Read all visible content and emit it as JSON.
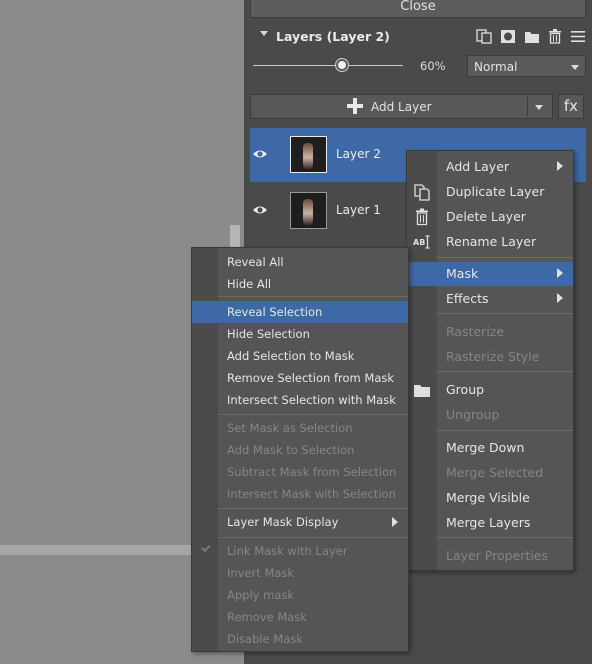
{
  "panel": {
    "close_label": "Close",
    "layers_title": "Layers (Layer 2)",
    "opacity": "60%",
    "opacity_fraction": 0.6,
    "blend_mode": "Normal",
    "add_layer_label": "Add Layer",
    "fx_label": "fx"
  },
  "layers": [
    {
      "name": "Layer 2",
      "selected": true,
      "visible": true
    },
    {
      "name": "Layer 1",
      "selected": false,
      "visible": true
    }
  ],
  "layer_menu": {
    "items": [
      {
        "label": "Add Layer",
        "submenu": true
      },
      {
        "label": "Duplicate Layer",
        "icon": "duplicate-icon"
      },
      {
        "label": "Delete Layer",
        "icon": "trash-icon"
      },
      {
        "label": "Rename Layer",
        "icon": "rename-icon"
      },
      {
        "label": "Mask",
        "submenu": true,
        "highlighted": true
      },
      {
        "label": "Effects",
        "submenu": true
      },
      {
        "label": "Rasterize",
        "disabled": true
      },
      {
        "label": "Rasterize Style",
        "disabled": true
      },
      {
        "label": "Group",
        "icon": "folder-icon"
      },
      {
        "label": "Ungroup",
        "disabled": true
      },
      {
        "label": "Merge Down"
      },
      {
        "label": "Merge Selected",
        "disabled": true
      },
      {
        "label": "Merge Visible"
      },
      {
        "label": "Merge Layers"
      },
      {
        "label": "Layer Properties",
        "disabled": true
      }
    ]
  },
  "mask_menu": {
    "items": [
      {
        "label": "Reveal All"
      },
      {
        "label": "Hide All"
      },
      {
        "label": "Reveal Selection",
        "highlighted": true
      },
      {
        "label": "Hide Selection"
      },
      {
        "label": "Add Selection to Mask"
      },
      {
        "label": "Remove Selection from Mask"
      },
      {
        "label": "Intersect Selection with Mask"
      },
      {
        "label": "Set Mask as Selection",
        "disabled": true
      },
      {
        "label": "Add Mask to Selection",
        "disabled": true
      },
      {
        "label": "Subtract Mask from Selection",
        "disabled": true
      },
      {
        "label": "Intersect Mask with Selection",
        "disabled": true
      },
      {
        "label": "Layer Mask Display",
        "submenu": true
      },
      {
        "label": "Link Mask with Layer",
        "disabled": true,
        "checked": true
      },
      {
        "label": "Invert Mask",
        "disabled": true
      },
      {
        "label": "Apply mask",
        "disabled": true
      },
      {
        "label": "Remove Mask",
        "disabled": true
      },
      {
        "label": "Disable Mask",
        "disabled": true
      }
    ]
  },
  "colors": {
    "highlight": "#3d69a6",
    "panel_bg": "#4a4a4a",
    "menu_bg": "#555555"
  }
}
